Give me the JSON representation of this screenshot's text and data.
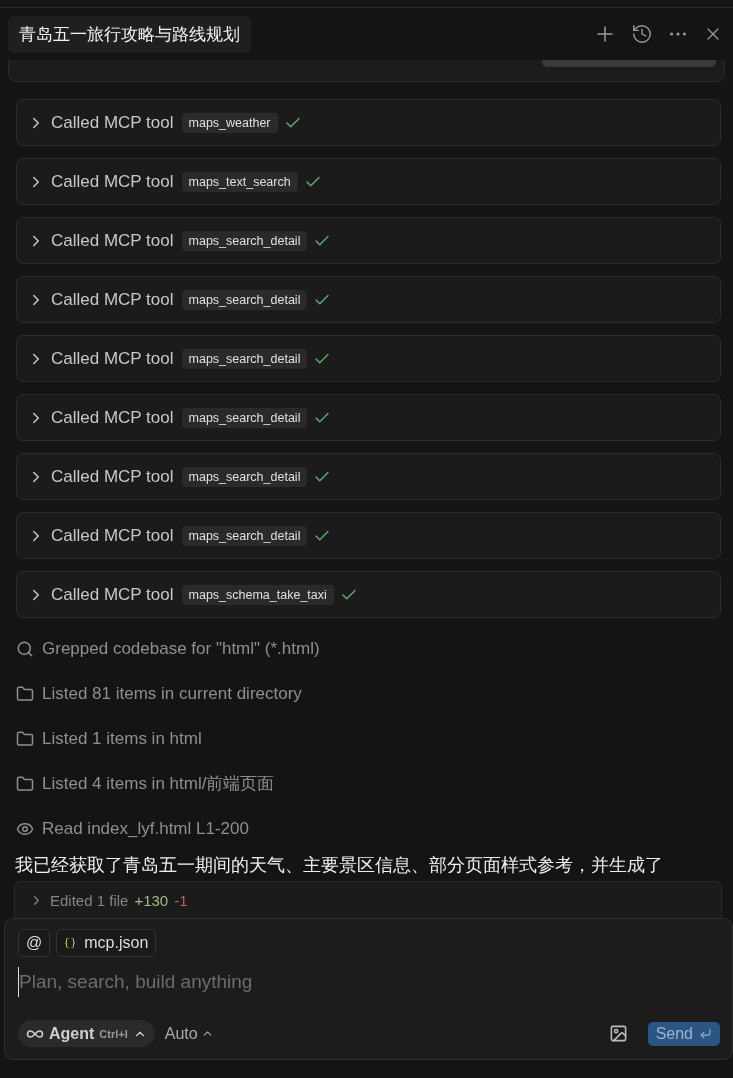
{
  "header": {
    "title": "青岛五一旅行攻略与路线规划"
  },
  "tool_calls": [
    {
      "label": "Called MCP tool",
      "tool": "maps_weather",
      "succeeded": true
    },
    {
      "label": "Called MCP tool",
      "tool": "maps_text_search",
      "succeeded": true
    },
    {
      "label": "Called MCP tool",
      "tool": "maps_search_detail",
      "succeeded": true
    },
    {
      "label": "Called MCP tool",
      "tool": "maps_search_detail",
      "succeeded": true
    },
    {
      "label": "Called MCP tool",
      "tool": "maps_search_detail",
      "succeeded": true
    },
    {
      "label": "Called MCP tool",
      "tool": "maps_search_detail",
      "succeeded": true
    },
    {
      "label": "Called MCP tool",
      "tool": "maps_search_detail",
      "succeeded": true
    },
    {
      "label": "Called MCP tool",
      "tool": "maps_search_detail",
      "succeeded": true
    },
    {
      "label": "Called MCP tool",
      "tool": "maps_schema_take_taxi",
      "succeeded": true
    }
  ],
  "activities": [
    {
      "kind": "search",
      "text": "Grepped codebase for \"html\" (*.html)"
    },
    {
      "kind": "folder",
      "text": "Listed 81 items in current directory"
    },
    {
      "kind": "folder",
      "text": "Listed 1 items in html"
    },
    {
      "kind": "folder",
      "text": "Listed 4 items in html/前端页面"
    },
    {
      "kind": "read",
      "text": "Read index_lyf.html L1-200"
    }
  ],
  "message": "我已经获取了青岛五一期间的天气、主要景区信息、部分页面样式参考，并生成了",
  "edits": {
    "label": "Edited 1 file",
    "added": "+130",
    "removed": "-1"
  },
  "composer": {
    "mention": "@",
    "context_file": "mcp.json",
    "placeholder": "Plan, search, build anything",
    "mode": "Agent",
    "shortcut": "Ctrl+I",
    "model": "Auto",
    "send": "Send"
  }
}
